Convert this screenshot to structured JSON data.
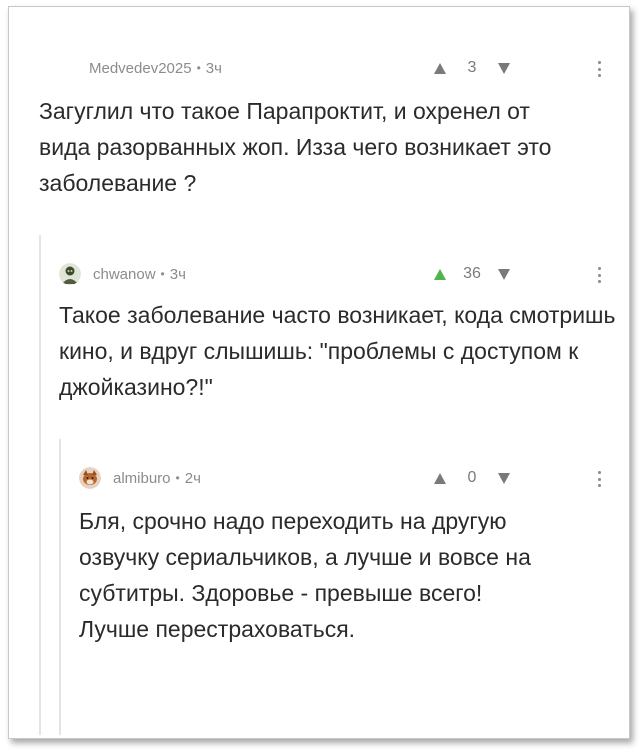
{
  "comments": [
    {
      "author": "Medvedev2025",
      "time": "3ч",
      "score": "3",
      "upvoted": false,
      "text": "Загуглил что такое Парапроктит, и охренел от вида разорванных жоп. Изза чего возникает это заболевание ?"
    },
    {
      "author": "chwanow",
      "time": "3ч",
      "score": "36",
      "upvoted": true,
      "text": "Такое заболевание часто возникает, кода смотришь кино, и вдруг слышишь: \"проблемы с доступом к джойказино?!\""
    },
    {
      "author": "almiburo",
      "time": "2ч",
      "score": "0",
      "upvoted": false,
      "text": "Бля, срочно надо переходить на другую озвучку сериальчиков, а лучше и вовсе на субтитры. Здоровье - превыше всего! Лучше перестраховаться."
    }
  ],
  "colors": {
    "upvote_active": "#50b34b",
    "meta_text": "#8c8c8c",
    "body_text": "#2b2b2b"
  },
  "icons": {
    "separator": "•"
  }
}
